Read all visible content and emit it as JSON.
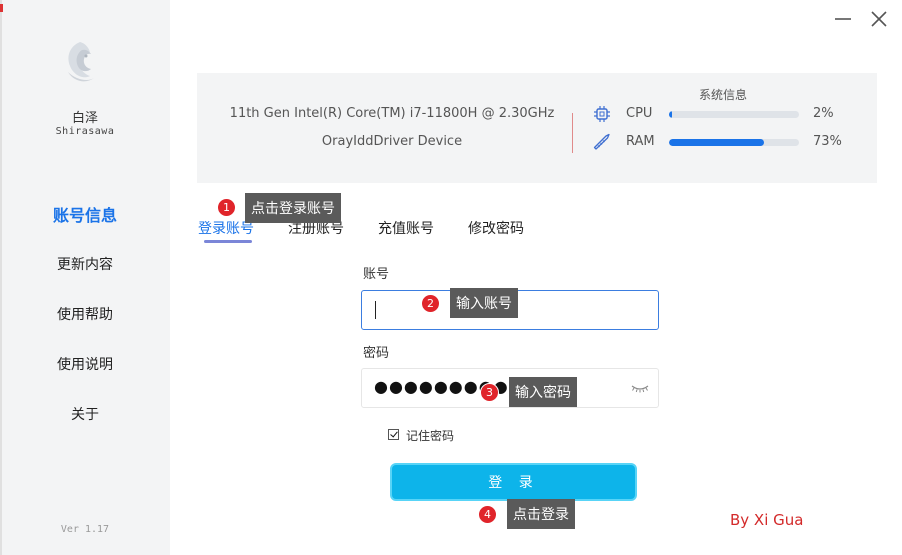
{
  "sidebar": {
    "app_name": "白泽",
    "app_subtitle": "Shirasawa",
    "items": [
      {
        "label": "账号信息",
        "active": true
      },
      {
        "label": "更新内容",
        "active": false
      },
      {
        "label": "使用帮助",
        "active": false
      },
      {
        "label": "使用说明",
        "active": false
      },
      {
        "label": "关于",
        "active": false
      }
    ],
    "version": "Ver 1.17"
  },
  "system_info": {
    "title": "系统信息",
    "cpu_model": "11th Gen Intel(R) Core(TM) i7-11800H @ 2.30GHz",
    "device": "OrayIddDriver Device",
    "resources": [
      {
        "label": "CPU",
        "value": "2%",
        "percent": 2,
        "icon": "chip-icon"
      },
      {
        "label": "RAM",
        "value": "73%",
        "percent": 73,
        "icon": "ram-stick-icon"
      }
    ]
  },
  "tabs": [
    {
      "label": "登录账号",
      "active": true
    },
    {
      "label": "注册账号",
      "active": false
    },
    {
      "label": "充值账号",
      "active": false
    },
    {
      "label": "修改密码",
      "active": false
    }
  ],
  "form": {
    "account_label": "账号",
    "account_value": "",
    "password_label": "密码",
    "password_masked": "●●●●●●●●●",
    "remember_label": "记住密码",
    "remember_checked": true,
    "login_button": "登 录"
  },
  "annotations": [
    {
      "number": "1",
      "text": "点击登录账号"
    },
    {
      "number": "2",
      "text": "输入账号"
    },
    {
      "number": "3",
      "text": "输入密码"
    },
    {
      "number": "4",
      "text": "点击登录"
    }
  ],
  "credit": "By Xi Gua",
  "colors": {
    "accent": "#1a73e8",
    "login_button": "#0db4ea",
    "badge": "#e0242a",
    "callout": "#5a5a5a",
    "credit": "#d32a2a"
  }
}
